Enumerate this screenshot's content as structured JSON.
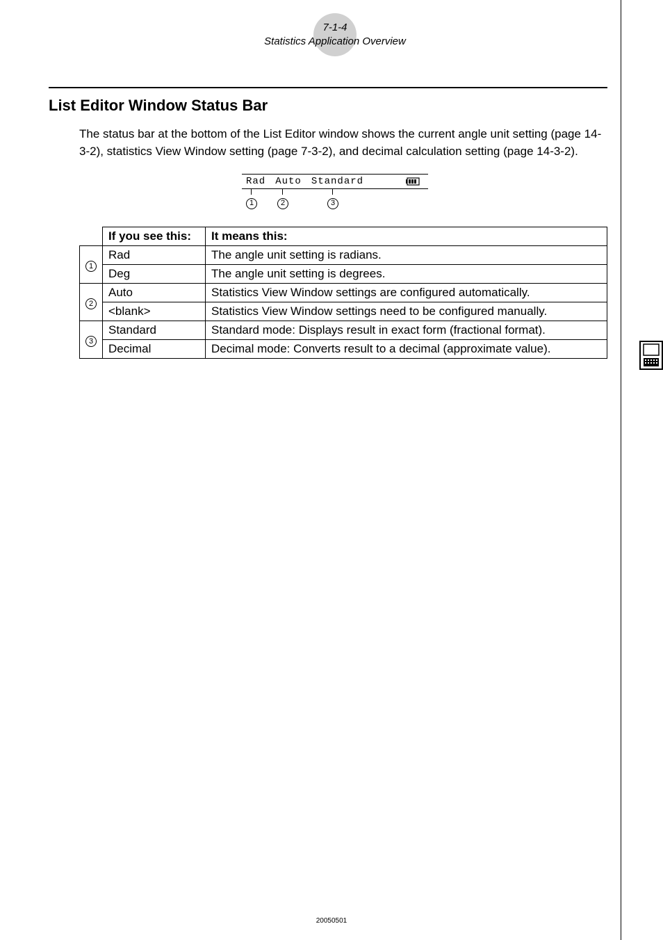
{
  "header": {
    "page_num": "7-1-4",
    "subtitle": "Statistics Application Overview"
  },
  "section": {
    "title": "List Editor Window Status Bar",
    "body": "The status bar at the bottom of the List Editor window shows the current angle unit setting (page 14-3-2), statistics View Window setting (page 7-3-2), and decimal calculation setting (page 14-3-2)."
  },
  "status_bar": {
    "item1": "Rad",
    "item2": "Auto",
    "item3": "Standard",
    "label1": "1",
    "label2": "2",
    "label3": "3"
  },
  "table": {
    "header_see": "If you see this:",
    "header_means": "It means this:",
    "rows": [
      {
        "num": "1",
        "see": "Rad",
        "means": "The angle unit setting is radians."
      },
      {
        "num": "",
        "see": "Deg",
        "means": "The angle unit setting is degrees."
      },
      {
        "num": "2",
        "see": "Auto",
        "means": "Statistics View Window settings are configured automatically."
      },
      {
        "num": "",
        "see": "<blank>",
        "means": "Statistics View Window settings need to be configured manually."
      },
      {
        "num": "3",
        "see": "Standard",
        "means": "Standard mode: Displays result in exact form (fractional format)."
      },
      {
        "num": "",
        "see": "Decimal",
        "means": "Decimal mode: Converts result to a decimal (approximate value)."
      }
    ]
  },
  "footer": {
    "date": "20050501"
  }
}
